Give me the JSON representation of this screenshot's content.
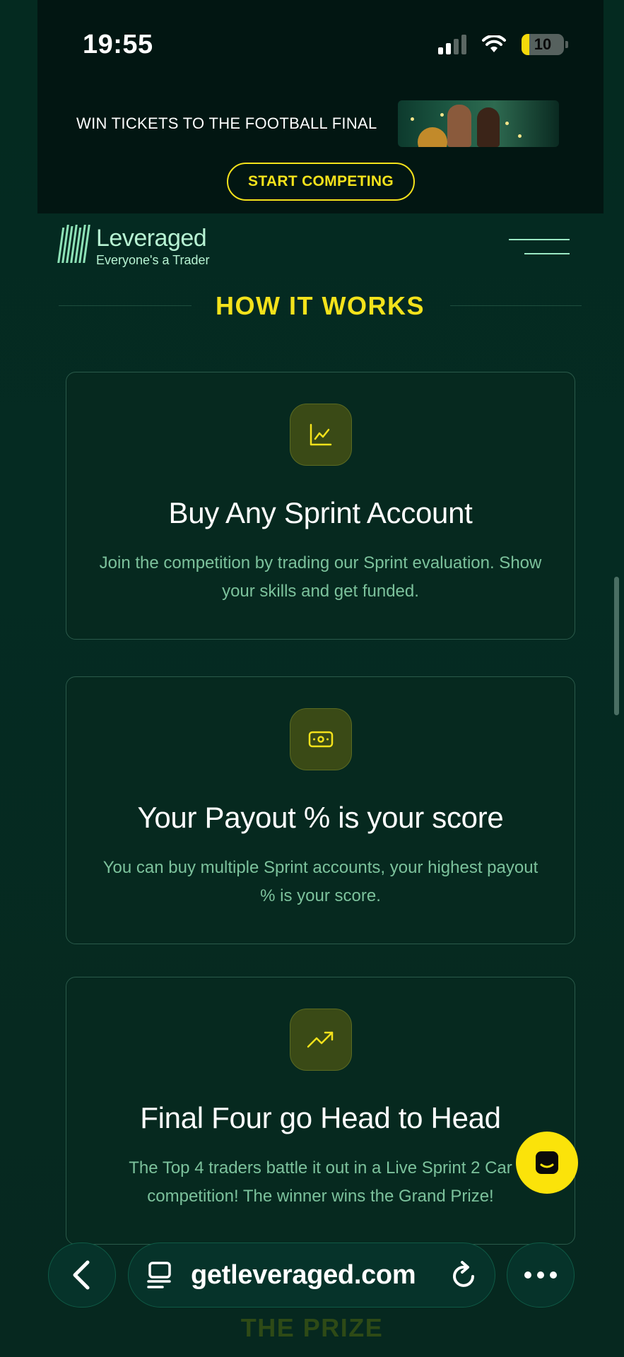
{
  "status_bar": {
    "time": "19:55",
    "battery_level": "10",
    "icons": [
      "cellular-signal-icon",
      "wifi-icon",
      "battery-icon"
    ]
  },
  "promo": {
    "text": "WIN TICKETS TO THE FOOTBALL FINAL",
    "button_label": "START COMPETING"
  },
  "nav": {
    "brand_name": "Leveraged",
    "brand_tagline": "Everyone's a Trader",
    "menu_icon": "menu-icon"
  },
  "section": {
    "title": "HOW IT WORKS"
  },
  "cards": [
    {
      "icon": "line-chart-icon",
      "title": "Buy Any Sprint Account",
      "description": "Join the competition by trading our Sprint evaluation. Show your skills and get funded."
    },
    {
      "icon": "cash-icon",
      "title": "Your Payout % is your score",
      "description": "You can buy multiple Sprint accounts, your highest payout % is your score."
    },
    {
      "icon": "trending-up-icon",
      "title": "Final Four go Head to Head",
      "description": "The Top 4 traders battle it out in a Live Sprint 2 Car competition! The winner wins the Grand Prize!"
    }
  ],
  "next_section": {
    "title": "THE PRIZE"
  },
  "browser": {
    "url": "getleveraged.com",
    "icons": [
      "back-arrow-icon",
      "tabs-icon",
      "reload-icon",
      "more-icon"
    ]
  },
  "colors": {
    "accent_yellow": "#f4e21b",
    "background": "#04261e",
    "mint": "#b7f3d3",
    "description_green": "#7cc29c"
  }
}
